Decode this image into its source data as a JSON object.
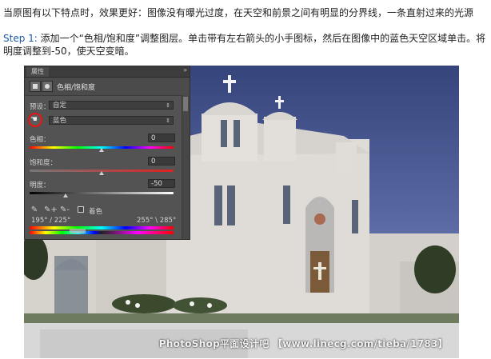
{
  "intro": "当原图有以下特点时，效果更好：图像没有曝光过度，在天空和前景之间有明显的分界线，一条直射过来的光源",
  "step": {
    "prefix": "Step 1:",
    "text": " 添加一个“色相/饱和度”调整图层。单击带有左右箭头的小手图标，然后在图像中的蓝色天空区域单击。将明度调整到-50，使天空变暗。"
  },
  "panel": {
    "tab": "属性",
    "collapse": "»",
    "title": "色相/饱和度",
    "preset_label": "预设：",
    "preset_value": "自定",
    "channel_value": "蓝色",
    "hue_label": "色相：",
    "hue_value": "0",
    "sat_label": "饱和度：",
    "sat_value": "0",
    "light_label": "明度：",
    "light_value": "-50",
    "colorize_label": "着色",
    "range_left": "195° / 225°",
    "range_right": "255° \\ 285°",
    "icons": {
      "adjustment": "adjustment-layer-icon",
      "mask": "mask-icon",
      "hand": "hand-scrubby-icon",
      "eyedropper": "eyedropper-icon",
      "eyedropper_plus": "eyedropper-plus-icon",
      "eyedropper_minus": "eyedropper-minus-icon",
      "dropdown": "chevron-updown-icon"
    },
    "glyphs": {
      "hand": "☚",
      "dropper": "✎",
      "dropper_plus": "✎+",
      "dropper_minus": "✎-",
      "updown": "⇕"
    }
  },
  "watermark": "PhotoShop平面设计吧 【www.linecg.com/tieba/1783】",
  "colors": {
    "panel_bg": "#535353",
    "sky": "#4c5a96",
    "highlight_circle": "#e11111",
    "step_prefix": "#1b57a8"
  }
}
